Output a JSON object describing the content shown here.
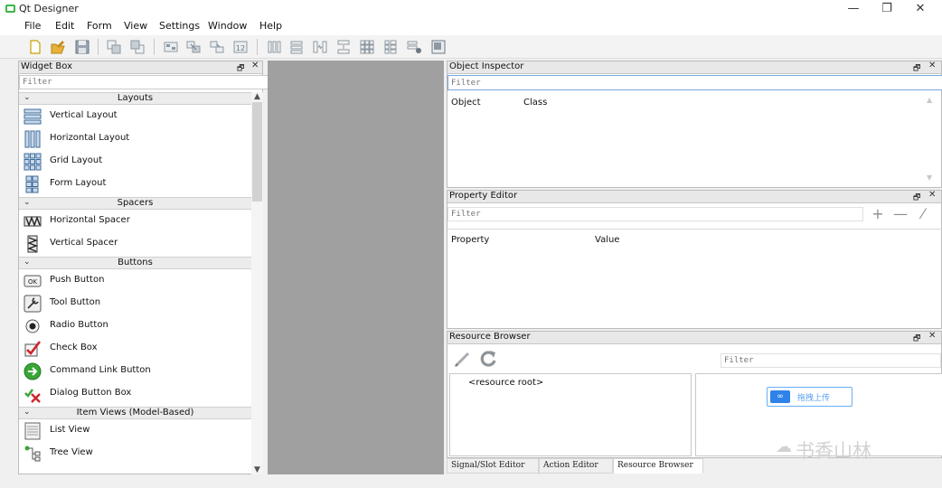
{
  "window": {
    "title": "Qt Designer",
    "minimize_glyph": "—",
    "maximize_glyph": "❐",
    "close_glyph": "✕"
  },
  "menubar": {
    "items": [
      "File",
      "Edit",
      "Form",
      "View",
      "Settings",
      "Window",
      "Help"
    ]
  },
  "toolbar": {
    "icons": [
      "new-form-icon",
      "open-form-icon",
      "save-form-icon",
      "send-to-back-icon",
      "bring-to-front-icon",
      "edit-widgets-icon",
      "edit-signals-slots-icon",
      "edit-buddies-icon",
      "edit-tab-order-icon",
      "lay-out-horizontally-icon",
      "lay-out-vertically-icon",
      "lay-out-horizontally-splitter-icon",
      "lay-out-vertically-splitter-icon",
      "lay-out-grid-icon",
      "lay-out-form-icon",
      "break-layout-icon",
      "adjust-size-icon"
    ]
  },
  "widget_box": {
    "title": "Widget Box",
    "float_glyph": "🗗",
    "close_glyph": "✕",
    "filter_placeholder": "Filter",
    "categories": [
      {
        "label": "Layouts",
        "items": [
          {
            "label": "Vertical Layout",
            "icon": "vertical-layout-icon"
          },
          {
            "label": "Horizontal Layout",
            "icon": "horizontal-layout-icon"
          },
          {
            "label": "Grid Layout",
            "icon": "grid-layout-icon"
          },
          {
            "label": "Form Layout",
            "icon": "form-layout-icon"
          }
        ]
      },
      {
        "label": "Spacers",
        "items": [
          {
            "label": "Horizontal Spacer",
            "icon": "horizontal-spacer-icon"
          },
          {
            "label": "Vertical Spacer",
            "icon": "vertical-spacer-icon"
          }
        ]
      },
      {
        "label": "Buttons",
        "items": [
          {
            "label": "Push Button",
            "icon": "push-button-icon"
          },
          {
            "label": "Tool Button",
            "icon": "tool-button-icon"
          },
          {
            "label": "Radio Button",
            "icon": "radio-button-icon"
          },
          {
            "label": "Check Box",
            "icon": "check-box-icon"
          },
          {
            "label": "Command Link Button",
            "icon": "command-link-button-icon"
          },
          {
            "label": "Dialog Button Box",
            "icon": "dialog-button-box-icon"
          }
        ]
      },
      {
        "label": "Item Views (Model-Based)",
        "items": [
          {
            "label": "List View",
            "icon": "list-view-icon"
          },
          {
            "label": "Tree View",
            "icon": "tree-view-icon"
          }
        ]
      }
    ],
    "push_button_icon_text": "OK"
  },
  "object_inspector": {
    "title": "Object Inspector",
    "filter_placeholder": "Filter",
    "columns": [
      "Object",
      "Class"
    ]
  },
  "property_editor": {
    "title": "Property Editor",
    "filter_placeholder": "Filter",
    "columns": [
      "Property",
      "Value"
    ],
    "tools": [
      {
        "glyph": "+",
        "icon": "add-dynamic-property-icon"
      },
      {
        "glyph": "—",
        "icon": "remove-dynamic-property-icon"
      },
      {
        "glyph": "⁄",
        "icon": "configure-icon"
      }
    ]
  },
  "resource_browser": {
    "title": "Resource Browser",
    "filter_placeholder": "Filter",
    "tree_root": "<resource root>",
    "upload_label": "拖拽上传",
    "upload_glyph": "∞"
  },
  "bottom_tabs": {
    "items": [
      {
        "label": "Signal/Slot Editor"
      },
      {
        "label": "Action Editor"
      },
      {
        "label": "Resource Browser",
        "active": true
      }
    ]
  },
  "watermark": {
    "text": "书香山林",
    "glyph": "☁"
  },
  "colors": {
    "form_area": "#a0a0a0",
    "accent_blue": "#2f82e8",
    "check_red": "#d0242b",
    "command_link_green": "#3aa537"
  }
}
